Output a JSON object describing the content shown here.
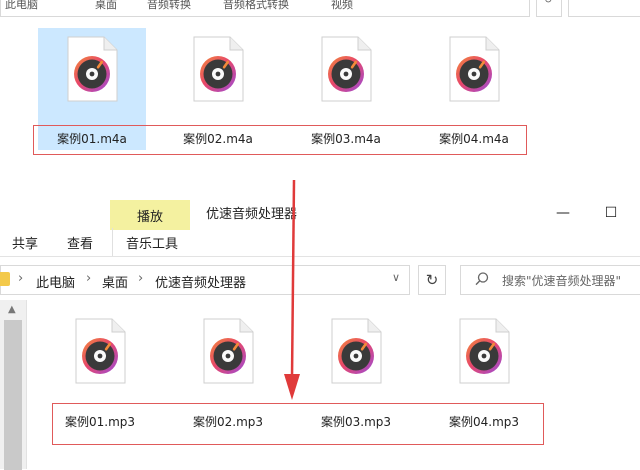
{
  "top_window": {
    "path_fragments": [
      "此电脑",
      "桌面",
      "音频转换",
      "音频格式转换",
      "视频"
    ],
    "files": [
      "案例01.m4a",
      "案例02.m4a",
      "案例03.m4a",
      "案例04.m4a"
    ],
    "selected_index": 0
  },
  "bottom_window": {
    "ribbon": {
      "context_tab": "播放",
      "title": "优速音频处理器",
      "tabs": [
        "共享",
        "查看"
      ],
      "context_subtab": "音乐工具",
      "minimize": "—",
      "maximize": "☐"
    },
    "address": {
      "crumbs": [
        "此电脑",
        "桌面",
        "优速音频处理器"
      ],
      "separator": "›",
      "dropdown": "∨",
      "refresh": "↻"
    },
    "search": {
      "placeholder": "搜索\"优速音频处理器\""
    },
    "scroll_up": "▲",
    "files": [
      "案例01.mp3",
      "案例02.mp3",
      "案例03.mp3",
      "案例04.mp3"
    ]
  },
  "colors": {
    "highlight_box": "#e05a5a",
    "arrow": "#e03a3a",
    "selection": "#cce8ff",
    "play_tab": "#f4f1a0"
  },
  "icons": {
    "file": "music-disc-file-icon",
    "search": "search-icon",
    "refresh": "refresh-icon",
    "folder": "folder-icon"
  }
}
